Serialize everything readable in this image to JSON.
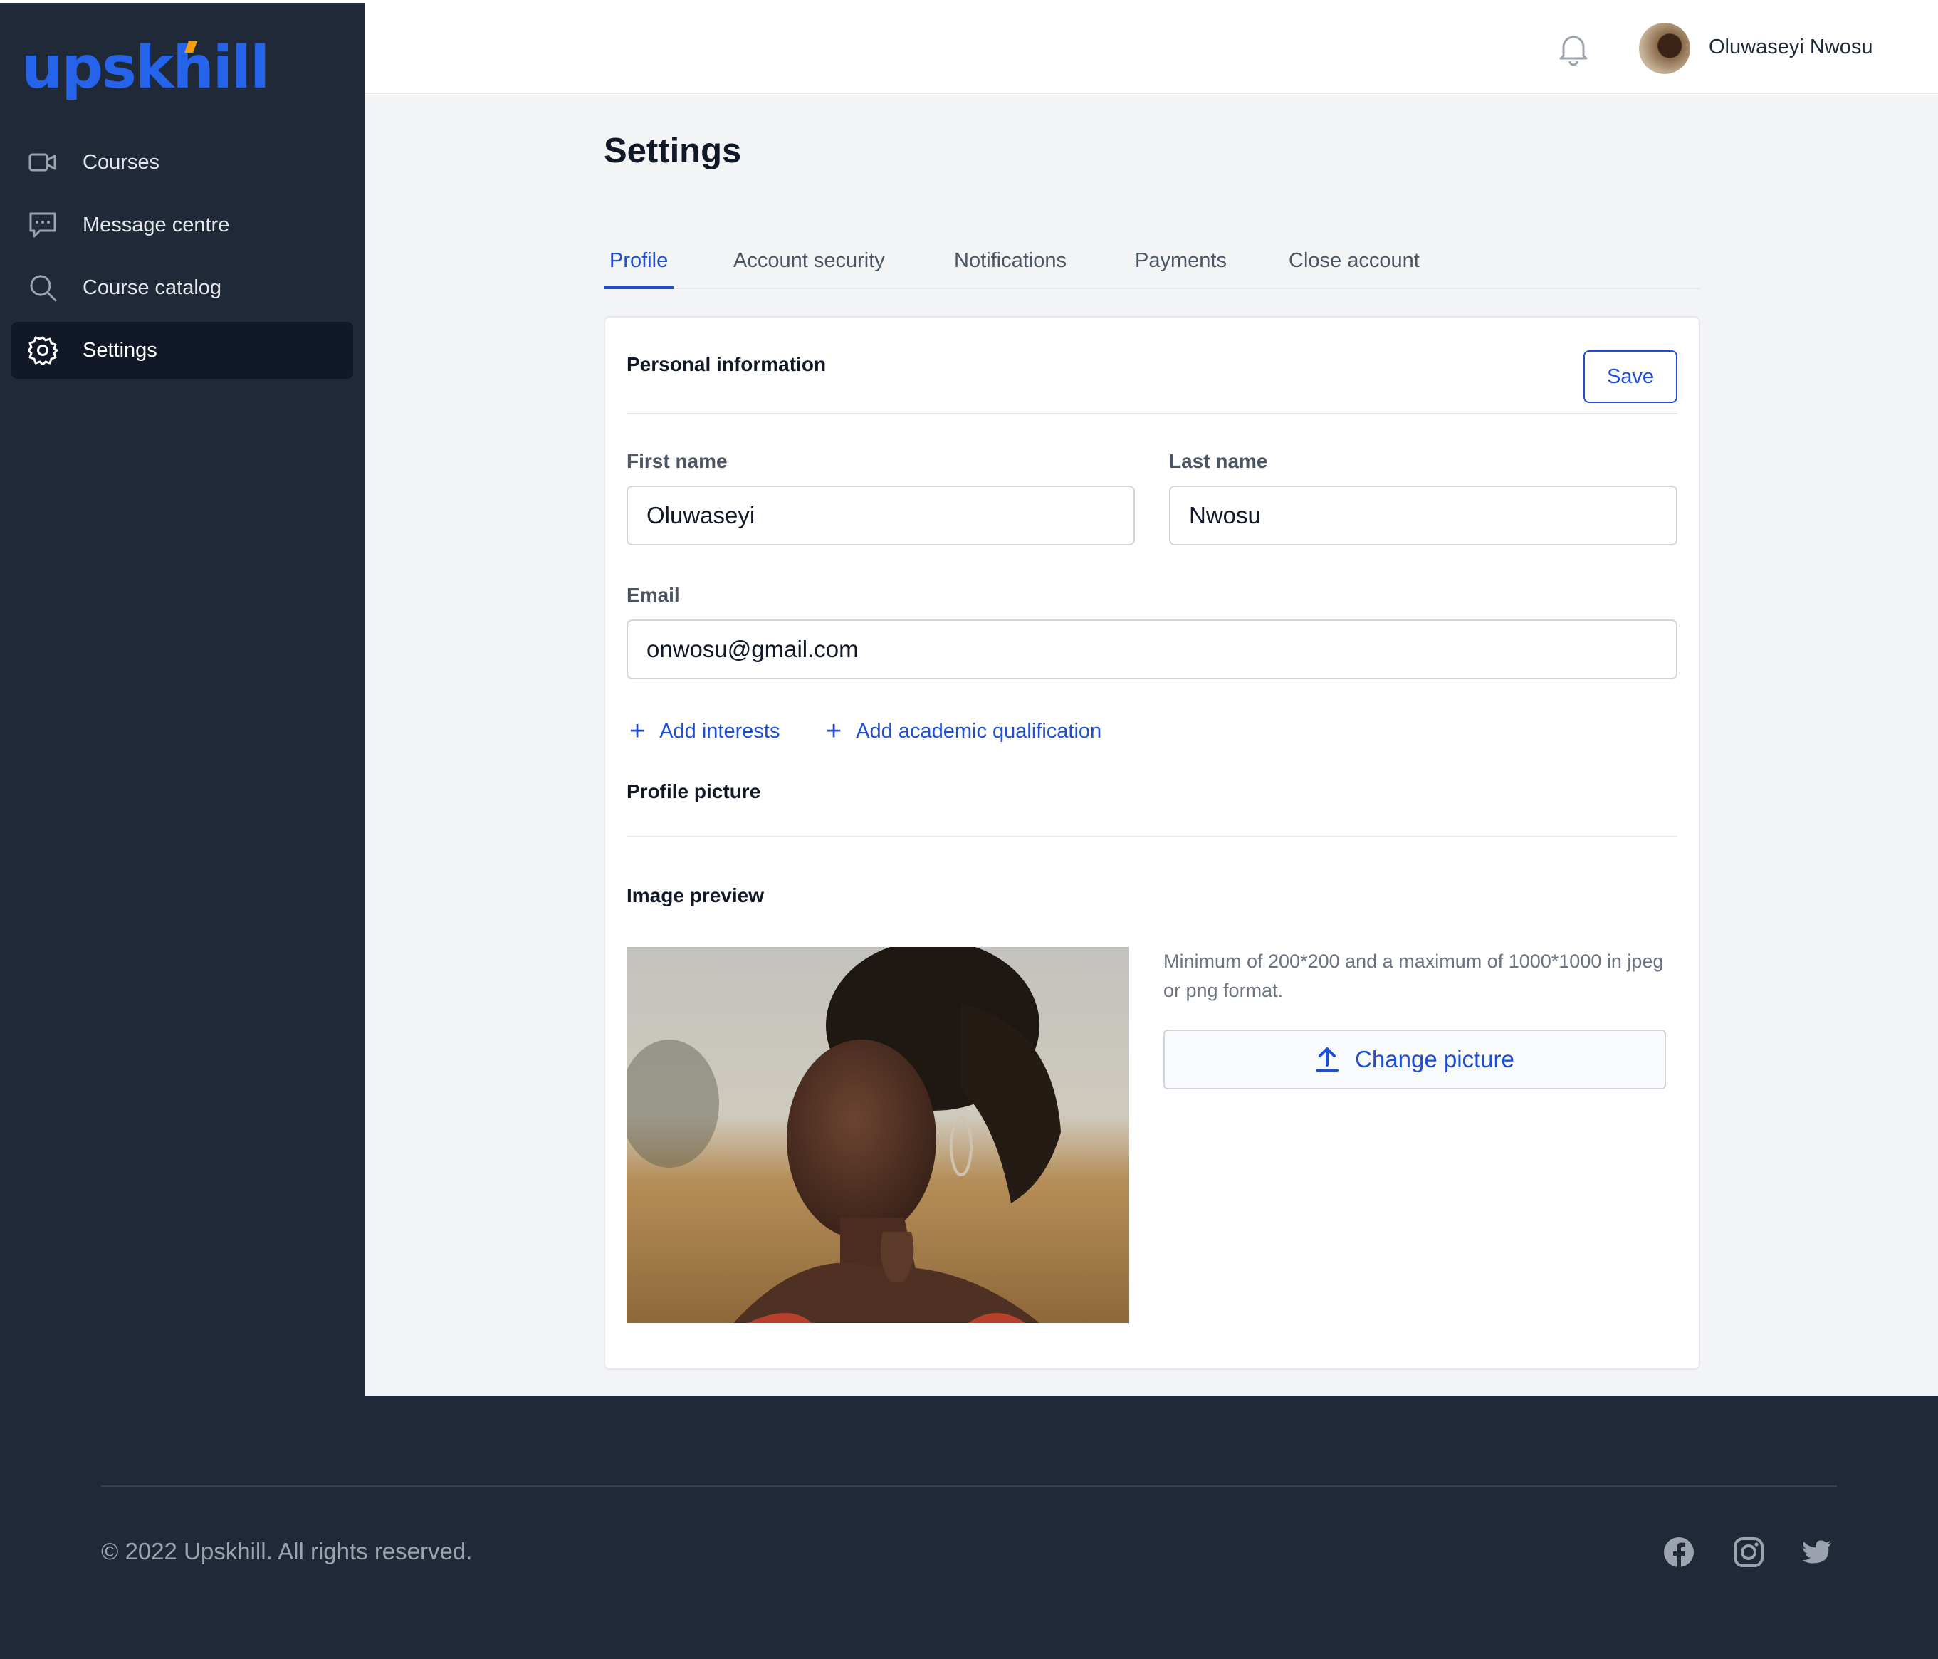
{
  "brand": {
    "logo_text": "upskhill",
    "logo_color": "#2563eb",
    "accent_color": "#f59e0b"
  },
  "sidebar": {
    "items": [
      {
        "label": "Courses",
        "icon": "video-icon",
        "active": false
      },
      {
        "label": "Message centre",
        "icon": "chat-icon",
        "active": false
      },
      {
        "label": "Course catalog",
        "icon": "search-icon",
        "active": false
      },
      {
        "label": "Settings",
        "icon": "gear-icon",
        "active": true
      }
    ]
  },
  "header": {
    "user_name": "Oluwaseyi Nwosu",
    "notification_icon": "bell-icon"
  },
  "main": {
    "title": "Settings",
    "tabs": [
      {
        "label": "Profile",
        "active": true
      },
      {
        "label": "Account security",
        "active": false
      },
      {
        "label": "Notifications",
        "active": false
      },
      {
        "label": "Payments",
        "active": false
      },
      {
        "label": "Close account",
        "active": false
      }
    ],
    "personal_info": {
      "title": "Personal information",
      "save_label": "Save",
      "first_name_label": "First name",
      "first_name_value": "Oluwaseyi",
      "last_name_label": "Last name",
      "last_name_value": "Nwosu",
      "email_label": "Email",
      "email_value": "onwosu@gmail.com",
      "add_interests": "Add interests",
      "add_qualification": "Add academic qualification"
    },
    "profile_picture": {
      "title": "Profile picture",
      "preview_title": "Image preview",
      "hint": "Minimum of 200*200 and a maximum of 1000*1000 in jpeg or png format.",
      "change_label": "Change picture"
    }
  },
  "footer": {
    "copyright": "© 2022 Upskhill. All rights reserved.",
    "social_icons": [
      "facebook-icon",
      "instagram-icon",
      "twitter-icon"
    ]
  },
  "colors": {
    "primary": "#1d4ed8",
    "sidebar_bg": "#1f2937",
    "main_bg": "#f3f4f6"
  }
}
